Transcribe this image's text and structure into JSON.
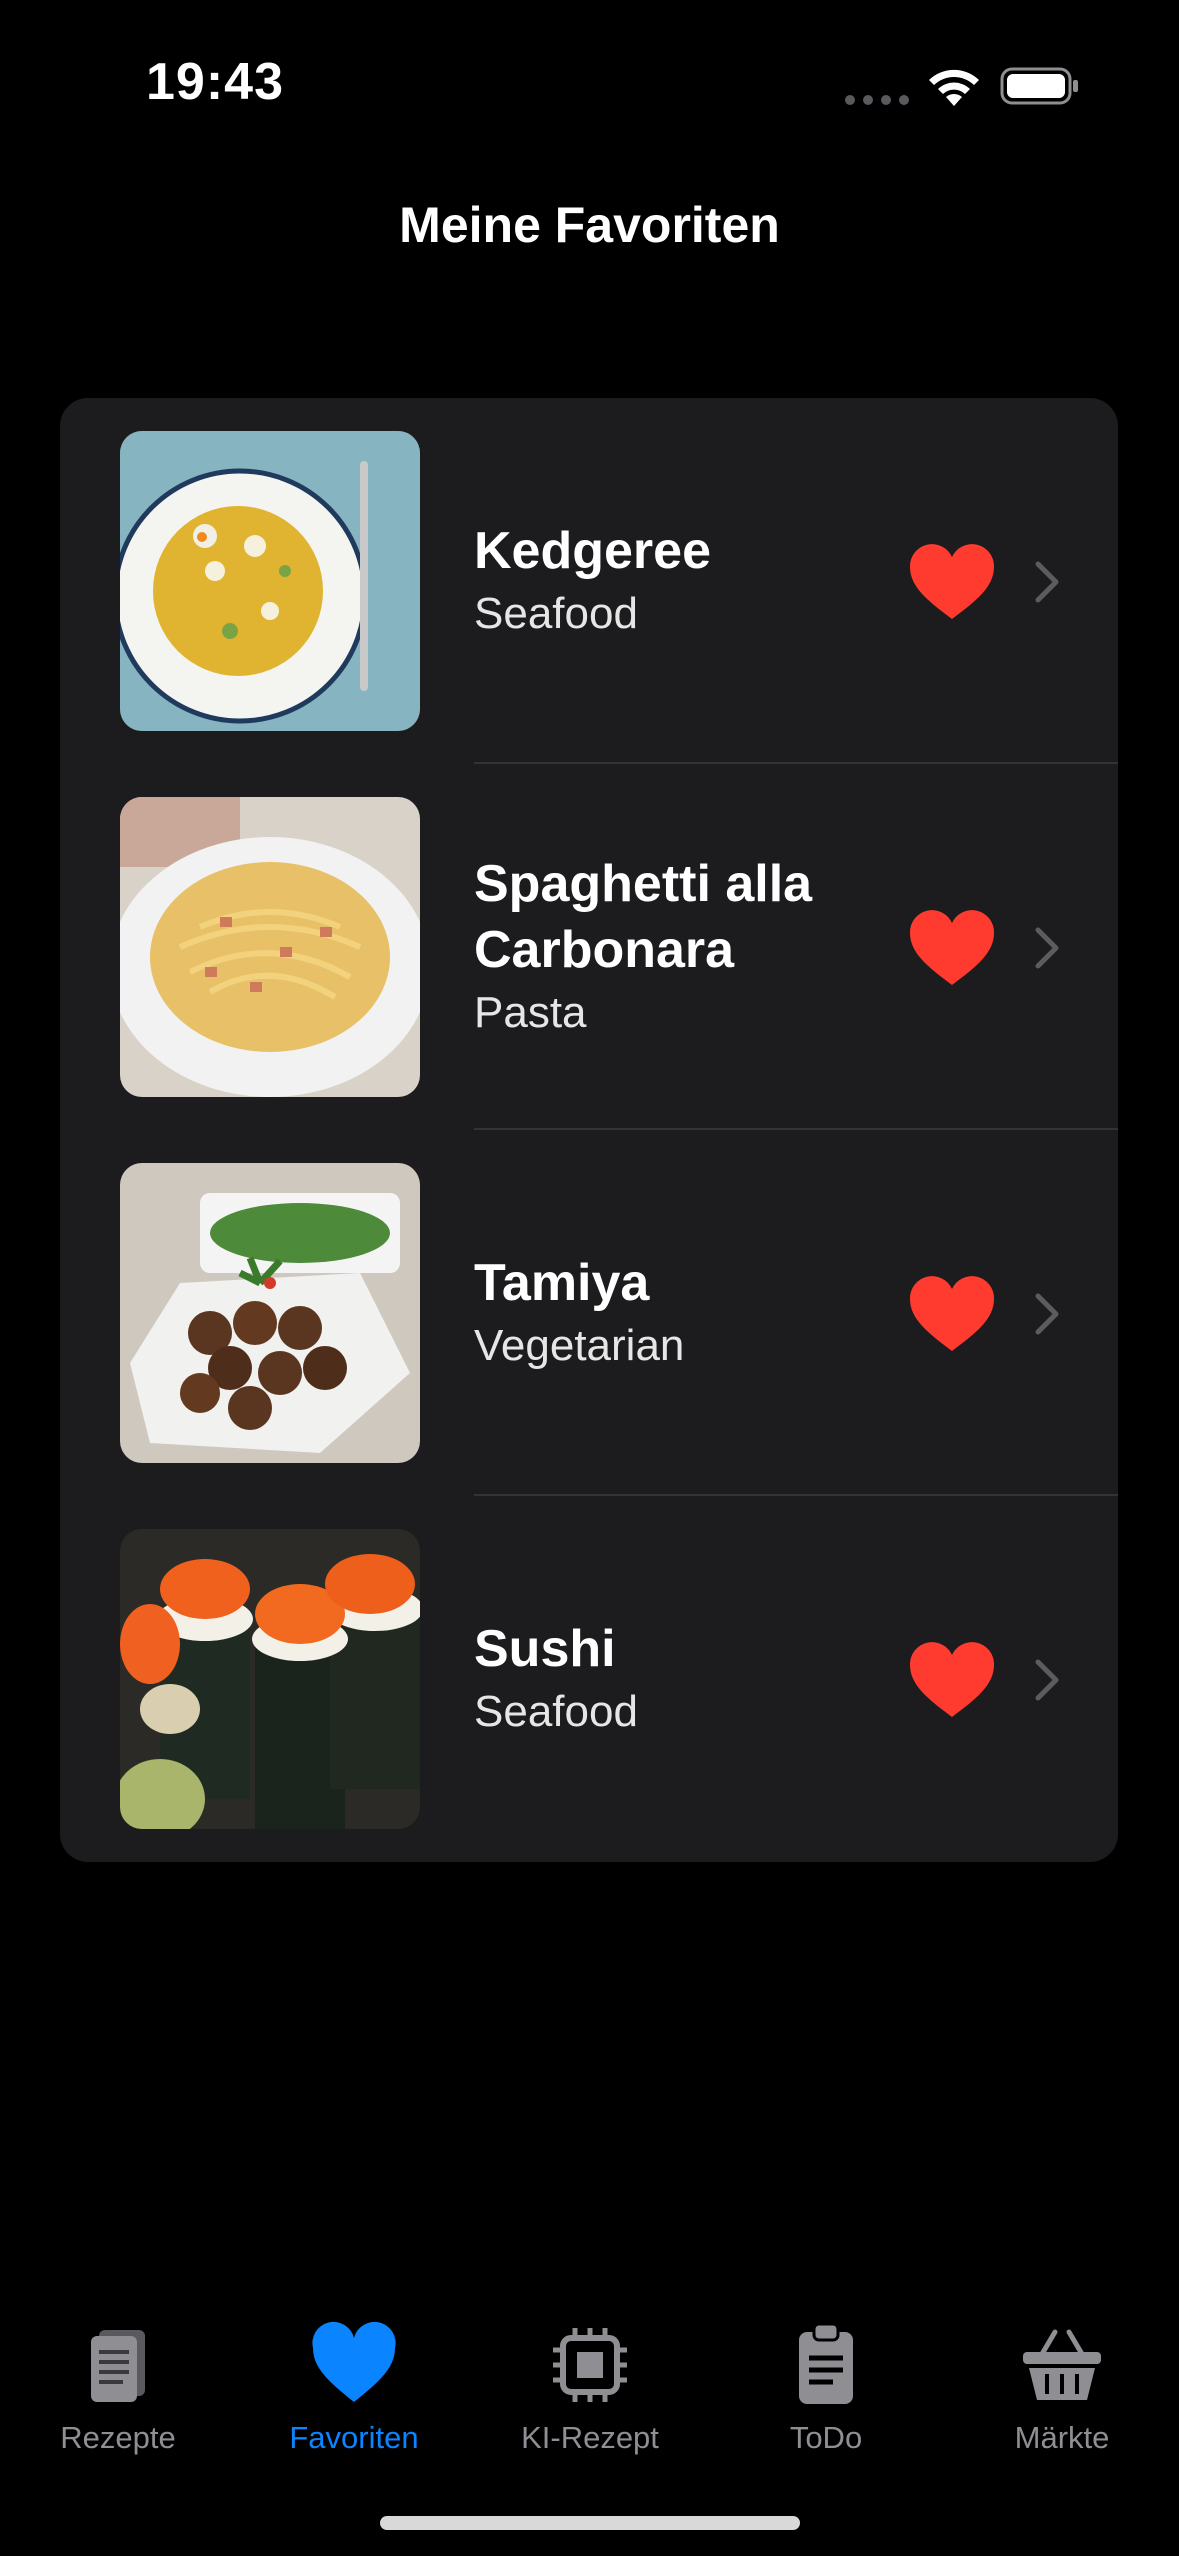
{
  "status": {
    "time": "19:43"
  },
  "header": {
    "title": "Meine Favoriten"
  },
  "favorites": [
    {
      "name": "Kedgeree",
      "category": "Seafood"
    },
    {
      "name": "Spaghetti alla Carbonara",
      "category": "Pasta"
    },
    {
      "name": "Tamiya",
      "category": "Vegetarian"
    },
    {
      "name": "Sushi",
      "category": "Seafood"
    }
  ],
  "tabs": [
    {
      "label": "Rezepte",
      "icon": "book-icon"
    },
    {
      "label": "Favoriten",
      "icon": "heart-icon",
      "active": true
    },
    {
      "label": "KI-Rezept",
      "icon": "chip-icon"
    },
    {
      "label": "ToDo",
      "icon": "clipboard-icon"
    },
    {
      "label": "Märkte",
      "icon": "basket-icon"
    }
  ],
  "colors": {
    "accent": "#0a84ff",
    "heart": "#ff3b30",
    "card": "#1c1c1e"
  }
}
